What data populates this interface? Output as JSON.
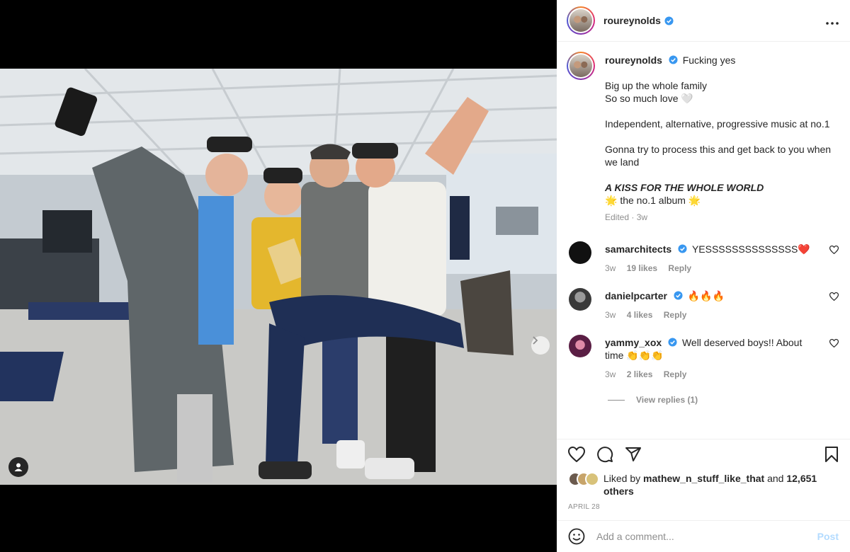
{
  "post": {
    "username": "roureynolds",
    "caption": {
      "username": "roureynolds",
      "first": "Fucking yes",
      "lines": [
        "Big up the whole family",
        "So so much love 🤍",
        "",
        "Independent, alternative, progressive music at no.1",
        "",
        "Gonna try to process this and get back to you when we land",
        ""
      ],
      "album": "A KISS FOR THE WHOLE WORLD",
      "album_line": "🌟 the no.1 album 🌟",
      "meta": "Edited · 3w"
    },
    "comments": [
      {
        "username": "samarchitects",
        "text": "YESSSSSSSSSSSSSS❤️",
        "time": "3w",
        "likes": "19 likes",
        "reply": "Reply",
        "avatar_color": "#111111"
      },
      {
        "username": "danielpcarter",
        "text": "🔥🔥🔥",
        "time": "3w",
        "likes": "4 likes",
        "reply": "Reply",
        "avatar_color": "#555555"
      },
      {
        "username": "yammy_xox",
        "text": "Well deserved boys!! About time 👏👏👏",
        "time": "3w",
        "likes": "2 likes",
        "reply": "Reply",
        "avatar_color": "#7a2e5c"
      }
    ],
    "view_replies": "View replies (1)",
    "likes": {
      "prefix": "Liked by ",
      "user": "mathew_n_stuff_like_that",
      "middle": " and ",
      "count": "12,651 others"
    },
    "date": "APRIL 28",
    "add_comment_placeholder": "Add a comment...",
    "post_label": "Post"
  },
  "icons": {
    "more": "more-options-icon",
    "heart": "heart-icon",
    "comment": "comment-icon",
    "share": "share-icon",
    "save": "bookmark-icon",
    "emoji": "emoji-icon",
    "next": "chevron-right-icon",
    "tag": "user-tag-icon",
    "verified": "verified-badge-icon"
  },
  "colors": {
    "verified": "#3897f0",
    "post_disabled": "#b3dbff",
    "secondary_text": "#8e8e8e"
  }
}
